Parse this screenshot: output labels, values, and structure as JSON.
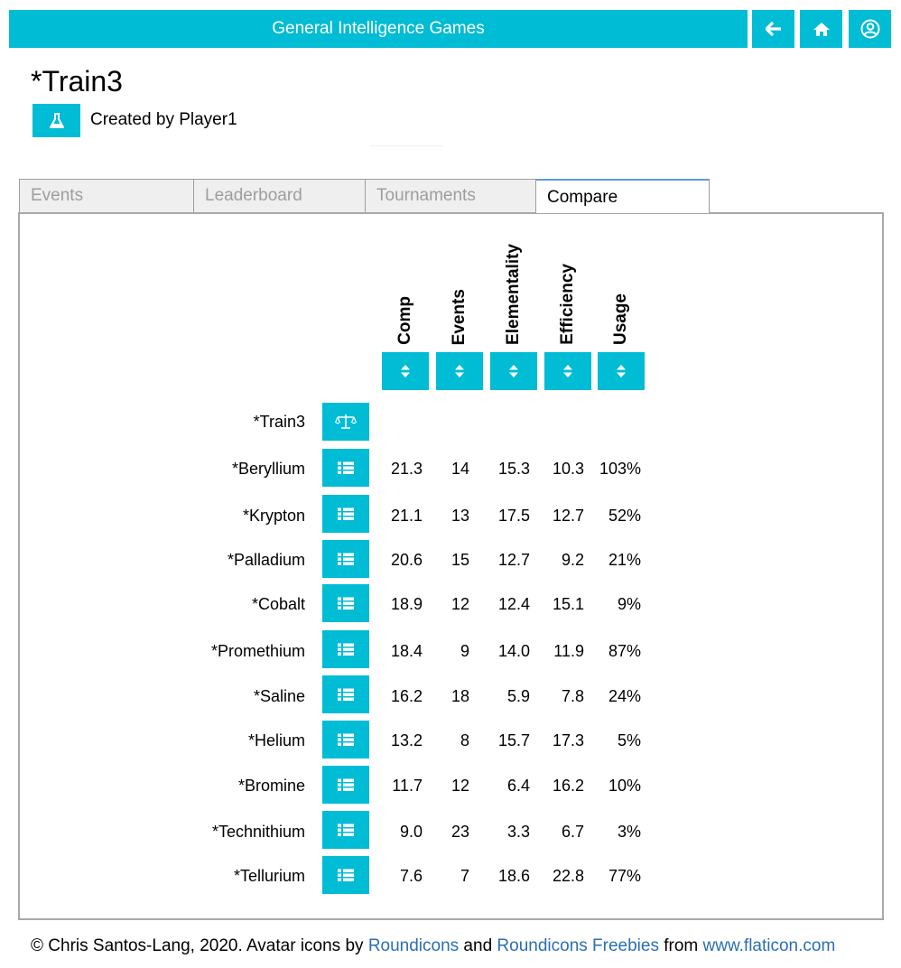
{
  "header": {
    "app_title": "General Intelligence Games",
    "accent_color": "#00bcd4",
    "nav": [
      {
        "icon": "arrow-left-icon",
        "label": "back"
      },
      {
        "icon": "home-icon",
        "label": "home"
      },
      {
        "icon": "user-circle-icon",
        "label": "account"
      }
    ]
  },
  "page": {
    "title": "*Train3",
    "created_by": "Created by Player1",
    "flask_icon": "flask-icon"
  },
  "tabs": [
    {
      "label": "Events",
      "active": false
    },
    {
      "label": "Leaderboard",
      "active": false
    },
    {
      "label": "Tournaments",
      "active": false
    },
    {
      "label": "Compare",
      "active": true
    }
  ],
  "compare": {
    "columns": [
      "Comp",
      "Events",
      "Elementality",
      "Efficiency",
      "Usage"
    ],
    "reference": {
      "name": "*Train3",
      "icon": "balance-scale-icon"
    },
    "rows": [
      {
        "name": "*Beryllium",
        "values": [
          "21.3",
          "14",
          "15.3",
          "10.3",
          "103%"
        ]
      },
      {
        "name": "*Krypton",
        "values": [
          "21.1",
          "13",
          "17.5",
          "12.7",
          "52%"
        ]
      },
      {
        "name": "*Palladium",
        "values": [
          "20.6",
          "15",
          "12.7",
          "9.2",
          "21%"
        ]
      },
      {
        "name": "*Cobalt",
        "values": [
          "18.9",
          "12",
          "12.4",
          "15.1",
          "9%"
        ]
      },
      {
        "name": "*Promethium",
        "values": [
          "18.4",
          "9",
          "14.0",
          "11.9",
          "87%"
        ]
      },
      {
        "name": "*Saline",
        "values": [
          "16.2",
          "18",
          "5.9",
          "7.8",
          "24%"
        ]
      },
      {
        "name": "*Helium",
        "values": [
          "13.2",
          "8",
          "15.7",
          "17.3",
          "5%"
        ]
      },
      {
        "name": "*Bromine",
        "values": [
          "11.7",
          "12",
          "6.4",
          "16.2",
          "10%"
        ]
      },
      {
        "name": "*Technithium",
        "values": [
          "9.0",
          "23",
          "3.3",
          "6.7",
          "3%"
        ]
      },
      {
        "name": "*Tellurium",
        "values": [
          "7.6",
          "7",
          "18.6",
          "22.8",
          "77%"
        ]
      }
    ]
  },
  "footer": {
    "prefix": "© Chris Santos-Lang, 2020. Avatar icons by ",
    "link1": "Roundicons",
    "and": " and ",
    "link2": "Roundicons Freebies",
    "from": " from ",
    "link3": "www.flaticon.com"
  }
}
